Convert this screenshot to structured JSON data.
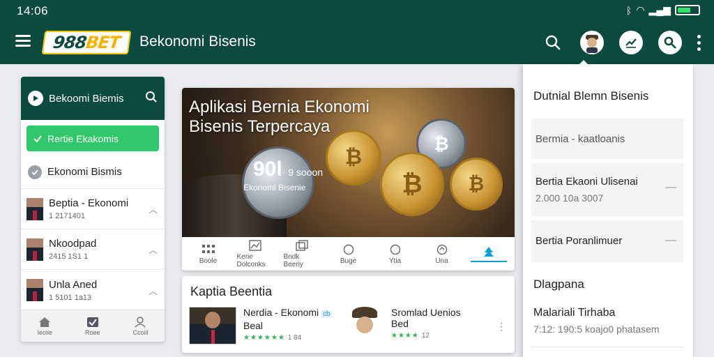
{
  "status_bar": {
    "time": "14:06",
    "icons": [
      "bluetooth-icon",
      "wifi-icon",
      "signal-icon",
      "battery-icon"
    ]
  },
  "appbar": {
    "logo": {
      "num": "988",
      "bet": "BET"
    },
    "title": "Bekonomi Bisenis",
    "actions": [
      "search-icon",
      "avatar",
      "trend-icon",
      "key-icon",
      "more-icon"
    ]
  },
  "left_panel": {
    "header": "Bekoomi Biemis",
    "cta": "Rertie Ekakomis",
    "row1": "Ekonomi Bismis",
    "items": [
      {
        "title": "Beptia - Ekonomi",
        "sub": "1 2171401"
      },
      {
        "title": "Nkoodpad",
        "sub": "2415 1S1 1"
      },
      {
        "title": "Unla Aned",
        "sub": "1 5101 1a13"
      }
    ],
    "tabs": [
      {
        "label": "Ieoiie"
      },
      {
        "label": "Roee"
      },
      {
        "label": "Ccoiil"
      }
    ]
  },
  "hero_card": {
    "title_line1": "Aplikasi Bernia Ekonomi",
    "title_line2": "Bisenis Terpercaya",
    "coin_big": "90l",
    "coin_small": "· 9 sooon",
    "coin_sub": "Ekonoml Bisenie",
    "tools": [
      {
        "label": "Boole",
        "icon": "grid-icon"
      },
      {
        "label": "Kerie Dolconks",
        "icon": "chart-icon"
      },
      {
        "label": "Bndk Beeriy",
        "icon": "layers-icon"
      },
      {
        "label": "Buge",
        "icon": "circle-icon"
      },
      {
        "label": "Ytia",
        "icon": "circle-icon"
      },
      {
        "label": "Una",
        "icon": "target-icon"
      },
      {
        "label": "",
        "icon": "tree-icon"
      }
    ]
  },
  "news_card": {
    "title": "Kaptia Beentia",
    "items": [
      {
        "title_line1": "Nerdia - Ekonomi",
        "title_line2": "Beal",
        "stars": "★★★★★★",
        "count": "1 84",
        "tag": "cb"
      },
      {
        "title_line1": "Sromlad Uenios",
        "title_line2": "Bed",
        "stars": "★★★★",
        "count": "12"
      }
    ],
    "more": "⋮"
  },
  "right_panel": {
    "title": "Dutnial Blemn Bisenis",
    "search_placeholder": "Bermia - kaatloanis",
    "items": [
      {
        "title": "Bertia Ekaoni Ulisenai",
        "sub": "2.000 10a 3007"
      },
      {
        "title": "Bertia Poranlimuer",
        "sub": ""
      }
    ],
    "section": "Dlagpana",
    "row": {
      "title": "Malariali Tirhaba",
      "sub": "7:12: 190:5 koajo0 phatasem"
    }
  },
  "colors": {
    "primary": "#0b4a3c",
    "accent_green": "#2fc76a",
    "logo_yellow": "#f5b400",
    "active_blue": "#0aa0d8"
  }
}
